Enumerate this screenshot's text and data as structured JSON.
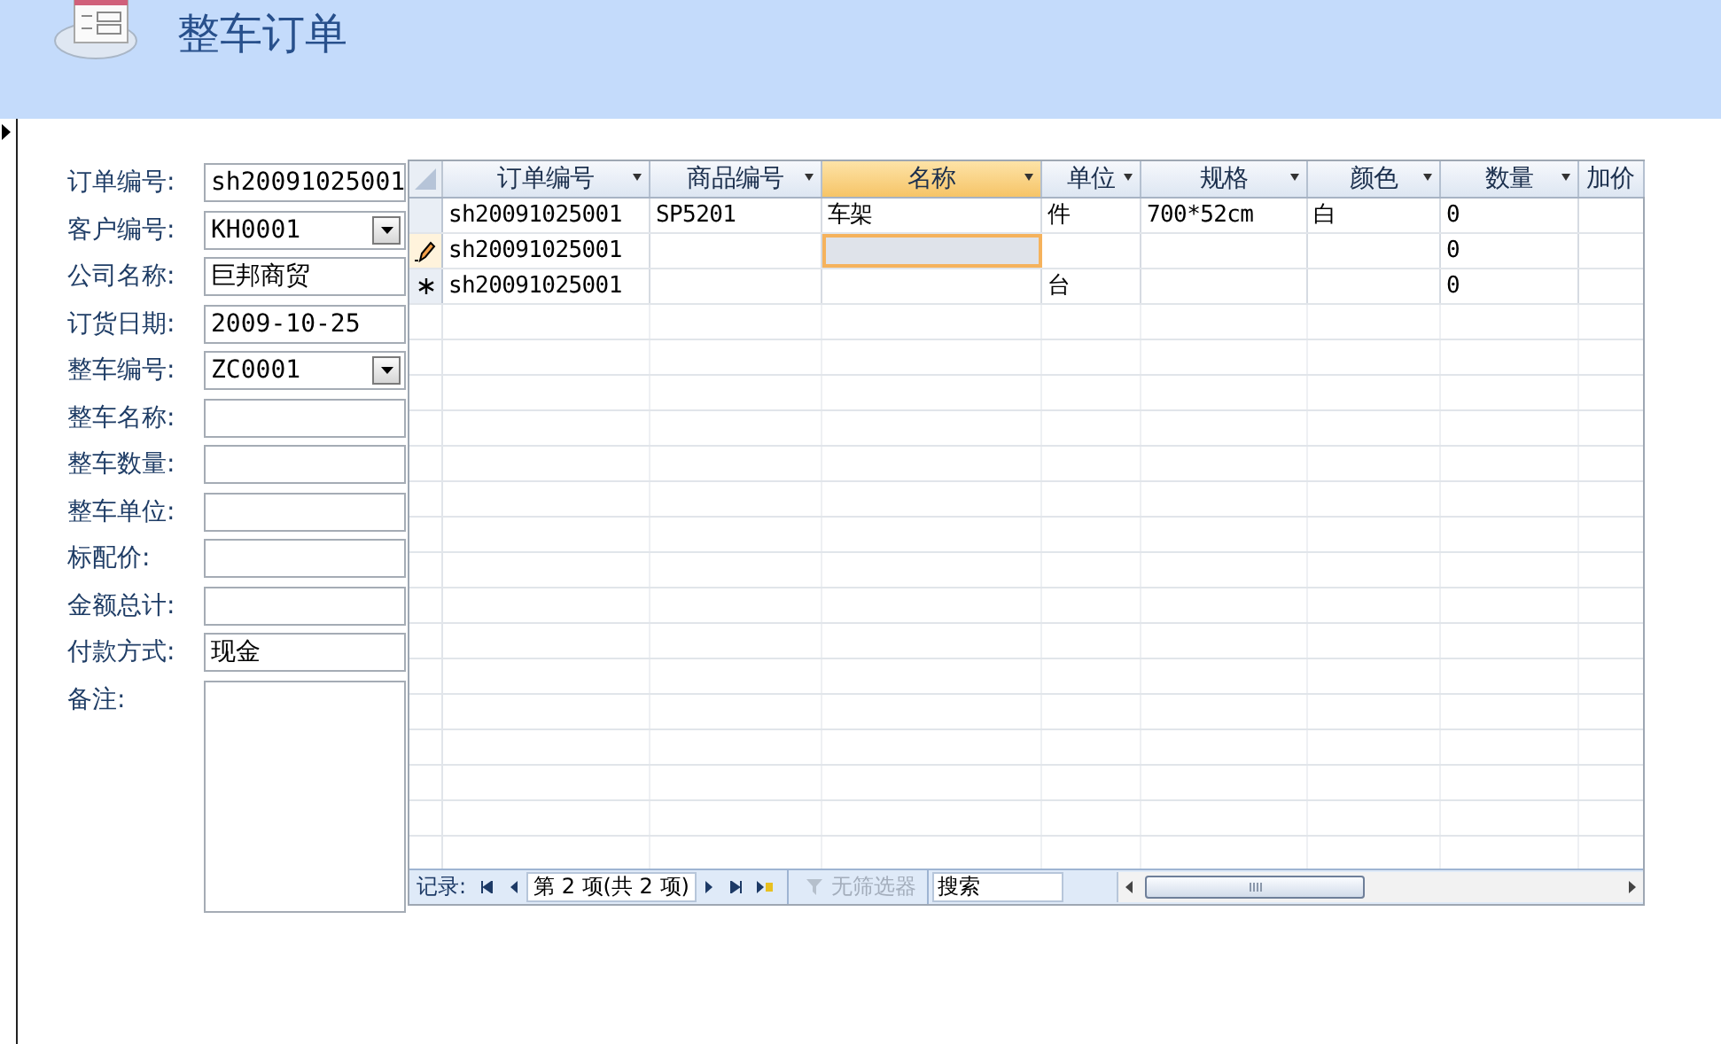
{
  "header": {
    "title": "整车订单"
  },
  "form": {
    "fields": [
      {
        "label": "订单编号:",
        "kind": "text",
        "value": "sh20091025001"
      },
      {
        "label": "客户编号:",
        "kind": "combo",
        "value": "KH0001"
      },
      {
        "label": "公司名称:",
        "kind": "text",
        "value": "巨邦商贸"
      },
      {
        "label": "订货日期:",
        "kind": "text",
        "value": "2009-10-25"
      },
      {
        "label": "整车编号:",
        "kind": "combo",
        "value": "ZC0001"
      },
      {
        "label": "整车名称:",
        "kind": "text"
      },
      {
        "label": "整车数量:",
        "kind": "text"
      },
      {
        "label": "整车单位:",
        "kind": "text"
      },
      {
        "label": "标配价:",
        "kind": "text"
      },
      {
        "label": "金额总计:",
        "kind": "text"
      },
      {
        "label": "付款方式:",
        "kind": "text",
        "value": "现金"
      },
      {
        "label": "备注:",
        "kind": "memo"
      }
    ]
  },
  "datasheet": {
    "columns": [
      {
        "label": "订单编号",
        "selected": false,
        "menu": true
      },
      {
        "label": "商品编号",
        "selected": false,
        "menu": true
      },
      {
        "label": "名称",
        "selected": true,
        "menu": true
      },
      {
        "label": "单位",
        "selected": false,
        "menu": true
      },
      {
        "label": "规格",
        "selected": false,
        "menu": true
      },
      {
        "label": "颜色",
        "selected": false,
        "menu": true
      },
      {
        "label": "数量",
        "selected": false,
        "menu": true
      },
      {
        "label": "加价",
        "selected": false,
        "menu": false
      }
    ],
    "rows": [
      {
        "kind": "record",
        "selected": false,
        "cells": [
          "sh20091025001",
          "SP5201",
          "车架",
          "件",
          "700*52cm",
          "白",
          "0",
          ""
        ]
      },
      {
        "kind": "editing",
        "selected": true,
        "cells": [
          "sh20091025001",
          "",
          "",
          "",
          "",
          "",
          "0",
          ""
        ]
      },
      {
        "kind": "new",
        "selected": false,
        "cells": [
          "sh20091025001",
          "",
          "",
          "台",
          "",
          "",
          "0",
          ""
        ]
      }
    ]
  },
  "navigator": {
    "label": "记录:",
    "position": "第 2 项(共 2 项)",
    "filter": {
      "label": "无筛选器",
      "disabled": true
    },
    "search": {
      "placeholder": "搜索"
    }
  }
}
